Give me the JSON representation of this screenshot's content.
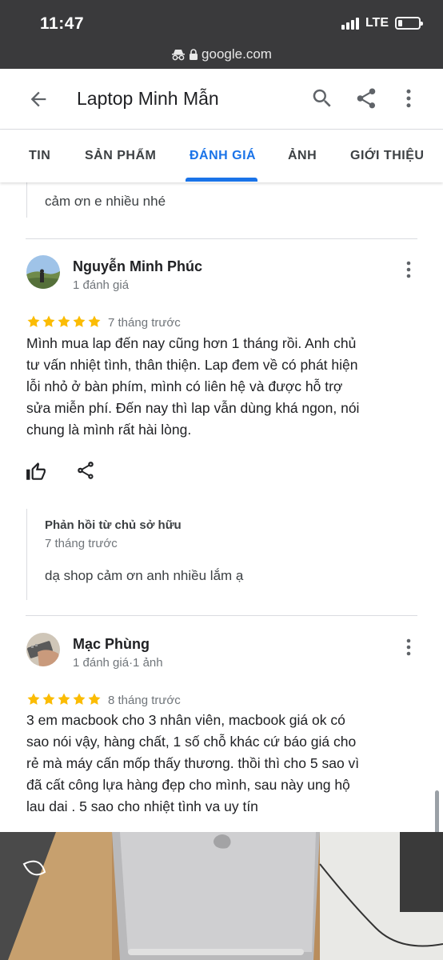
{
  "status": {
    "time": "11:47",
    "network": "LTE",
    "battery_level": 0.2
  },
  "browser": {
    "url": "google.com"
  },
  "header": {
    "title": "Laptop Minh Mẫn"
  },
  "tabs": [
    {
      "label": "TIN"
    },
    {
      "label": "SẢN PHẨM"
    },
    {
      "label": "ĐÁNH GIÁ",
      "active": true
    },
    {
      "label": "ẢNH"
    },
    {
      "label": "GIỚI THIỆU"
    }
  ],
  "prev_reply": {
    "text": "cảm ơn e nhiều nhé"
  },
  "reviews": [
    {
      "name": "Nguyễn Minh Phúc",
      "meta": "1 đánh giá",
      "rating": 5,
      "date": "7 tháng trước",
      "lines": [
        "Mình mua lap đến nay cũng hơn 1 tháng rồi. Anh chủ",
        "tư vấn nhiệt tình, thân thiện. Lap đem về có phát hiện",
        "lỗi nhỏ ở bàn phím, mình có liên hệ và được hỗ trợ",
        "sửa miễn phí. Đến nay thì lap vẫn dùng khá ngon, nói",
        "chung là mình rất hài lòng."
      ],
      "owner_reply": {
        "label": "Phản hồi từ chủ sở hữu",
        "date": "7 tháng trước",
        "text": "dạ shop cảm ơn anh nhiều lắm ạ"
      }
    },
    {
      "name": "Mạc Phùng",
      "meta": "1 đánh giá·1 ảnh",
      "rating": 5,
      "date": "8 tháng trước",
      "lines": [
        "3 em macbook cho 3 nhân viên, macbook giá ok có",
        "sao nói vậy, hàng chất, 1 số chỗ khác cứ báo giá cho",
        "rẻ mà máy cấn mốp thấy thương. thồi thì cho 5 sao vì",
        "đã cất công lựa hàng đẹp cho mình, sau này ung hộ",
        "lau dai . 5 sao cho nhiệt tình va uy tín"
      ]
    }
  ],
  "colors": {
    "accent": "#1a73e8",
    "star": "#fbbc04",
    "statusbar": "#3a3a3c"
  }
}
